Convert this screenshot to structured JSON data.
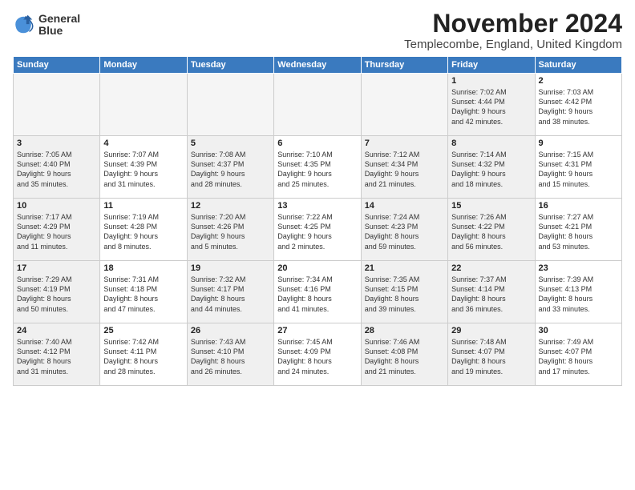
{
  "logo": {
    "line1": "General",
    "line2": "Blue"
  },
  "title": "November 2024",
  "location": "Templecombe, England, United Kingdom",
  "headers": [
    "Sunday",
    "Monday",
    "Tuesday",
    "Wednesday",
    "Thursday",
    "Friday",
    "Saturday"
  ],
  "weeks": [
    [
      {
        "day": "",
        "info": "",
        "empty": true
      },
      {
        "day": "",
        "info": "",
        "empty": true
      },
      {
        "day": "",
        "info": "",
        "empty": true
      },
      {
        "day": "",
        "info": "",
        "empty": true
      },
      {
        "day": "",
        "info": "",
        "empty": true
      },
      {
        "day": "1",
        "info": "Sunrise: 7:02 AM\nSunset: 4:44 PM\nDaylight: 9 hours\nand 42 minutes.",
        "shaded": true
      },
      {
        "day": "2",
        "info": "Sunrise: 7:03 AM\nSunset: 4:42 PM\nDaylight: 9 hours\nand 38 minutes."
      }
    ],
    [
      {
        "day": "3",
        "info": "Sunrise: 7:05 AM\nSunset: 4:40 PM\nDaylight: 9 hours\nand 35 minutes.",
        "shaded": true
      },
      {
        "day": "4",
        "info": "Sunrise: 7:07 AM\nSunset: 4:39 PM\nDaylight: 9 hours\nand 31 minutes."
      },
      {
        "day": "5",
        "info": "Sunrise: 7:08 AM\nSunset: 4:37 PM\nDaylight: 9 hours\nand 28 minutes.",
        "shaded": true
      },
      {
        "day": "6",
        "info": "Sunrise: 7:10 AM\nSunset: 4:35 PM\nDaylight: 9 hours\nand 25 minutes."
      },
      {
        "day": "7",
        "info": "Sunrise: 7:12 AM\nSunset: 4:34 PM\nDaylight: 9 hours\nand 21 minutes.",
        "shaded": true
      },
      {
        "day": "8",
        "info": "Sunrise: 7:14 AM\nSunset: 4:32 PM\nDaylight: 9 hours\nand 18 minutes.",
        "shaded": true
      },
      {
        "day": "9",
        "info": "Sunrise: 7:15 AM\nSunset: 4:31 PM\nDaylight: 9 hours\nand 15 minutes."
      }
    ],
    [
      {
        "day": "10",
        "info": "Sunrise: 7:17 AM\nSunset: 4:29 PM\nDaylight: 9 hours\nand 11 minutes.",
        "shaded": true
      },
      {
        "day": "11",
        "info": "Sunrise: 7:19 AM\nSunset: 4:28 PM\nDaylight: 9 hours\nand 8 minutes."
      },
      {
        "day": "12",
        "info": "Sunrise: 7:20 AM\nSunset: 4:26 PM\nDaylight: 9 hours\nand 5 minutes.",
        "shaded": true
      },
      {
        "day": "13",
        "info": "Sunrise: 7:22 AM\nSunset: 4:25 PM\nDaylight: 9 hours\nand 2 minutes."
      },
      {
        "day": "14",
        "info": "Sunrise: 7:24 AM\nSunset: 4:23 PM\nDaylight: 8 hours\nand 59 minutes.",
        "shaded": true
      },
      {
        "day": "15",
        "info": "Sunrise: 7:26 AM\nSunset: 4:22 PM\nDaylight: 8 hours\nand 56 minutes.",
        "shaded": true
      },
      {
        "day": "16",
        "info": "Sunrise: 7:27 AM\nSunset: 4:21 PM\nDaylight: 8 hours\nand 53 minutes."
      }
    ],
    [
      {
        "day": "17",
        "info": "Sunrise: 7:29 AM\nSunset: 4:19 PM\nDaylight: 8 hours\nand 50 minutes.",
        "shaded": true
      },
      {
        "day": "18",
        "info": "Sunrise: 7:31 AM\nSunset: 4:18 PM\nDaylight: 8 hours\nand 47 minutes."
      },
      {
        "day": "19",
        "info": "Sunrise: 7:32 AM\nSunset: 4:17 PM\nDaylight: 8 hours\nand 44 minutes.",
        "shaded": true
      },
      {
        "day": "20",
        "info": "Sunrise: 7:34 AM\nSunset: 4:16 PM\nDaylight: 8 hours\nand 41 minutes."
      },
      {
        "day": "21",
        "info": "Sunrise: 7:35 AM\nSunset: 4:15 PM\nDaylight: 8 hours\nand 39 minutes.",
        "shaded": true
      },
      {
        "day": "22",
        "info": "Sunrise: 7:37 AM\nSunset: 4:14 PM\nDaylight: 8 hours\nand 36 minutes.",
        "shaded": true
      },
      {
        "day": "23",
        "info": "Sunrise: 7:39 AM\nSunset: 4:13 PM\nDaylight: 8 hours\nand 33 minutes."
      }
    ],
    [
      {
        "day": "24",
        "info": "Sunrise: 7:40 AM\nSunset: 4:12 PM\nDaylight: 8 hours\nand 31 minutes.",
        "shaded": true
      },
      {
        "day": "25",
        "info": "Sunrise: 7:42 AM\nSunset: 4:11 PM\nDaylight: 8 hours\nand 28 minutes."
      },
      {
        "day": "26",
        "info": "Sunrise: 7:43 AM\nSunset: 4:10 PM\nDaylight: 8 hours\nand 26 minutes.",
        "shaded": true
      },
      {
        "day": "27",
        "info": "Sunrise: 7:45 AM\nSunset: 4:09 PM\nDaylight: 8 hours\nand 24 minutes."
      },
      {
        "day": "28",
        "info": "Sunrise: 7:46 AM\nSunset: 4:08 PM\nDaylight: 8 hours\nand 21 minutes.",
        "shaded": true
      },
      {
        "day": "29",
        "info": "Sunrise: 7:48 AM\nSunset: 4:07 PM\nDaylight: 8 hours\nand 19 minutes.",
        "shaded": true
      },
      {
        "day": "30",
        "info": "Sunrise: 7:49 AM\nSunset: 4:07 PM\nDaylight: 8 hours\nand 17 minutes."
      }
    ]
  ]
}
